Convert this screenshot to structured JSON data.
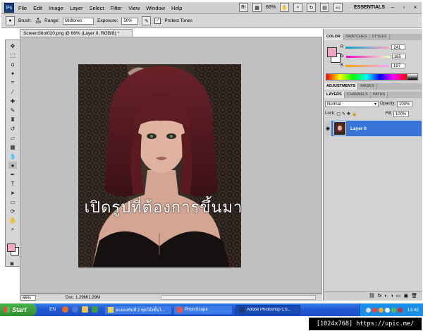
{
  "menubar": {
    "logo": "Ps",
    "items": [
      "File",
      "Edit",
      "Image",
      "Layer",
      "Select",
      "Filter",
      "View",
      "Window",
      "Help"
    ],
    "zoom": "66%",
    "workspace": "ESSENTIALS",
    "minimize": "–",
    "restore": "▫",
    "close": "×"
  },
  "options": {
    "brush_label": "Brush:",
    "brush_size": "109",
    "range_label": "Range:",
    "range_value": "Midtones",
    "exposure_label": "Exposure:",
    "exposure_value": "50%",
    "protect_label": "Protect Tones",
    "protect_checked": true
  },
  "document": {
    "tab_title": "ScreenShot020.png @ 66% (Layer 0, RGB/8) *",
    "overlay_text": "เปิดรูปที่ต้องการขึ้นมา",
    "status_zoom": "66%",
    "status_doc": "Doc: 1.29M/1.29M"
  },
  "color_panel": {
    "tabs": [
      "COLOR",
      "SWATCHES",
      "STYLES"
    ],
    "r_label": "R",
    "r": "241",
    "g_label": "G",
    "g": "165",
    "b_label": "B",
    "b": "197",
    "foreground": "#f1a5c5"
  },
  "adjustments": {
    "tabs": [
      "ADJUSTMENTS",
      "MASKS"
    ]
  },
  "layers_panel": {
    "tabs": [
      "LAYERS",
      "CHANNELS",
      "PATHS"
    ],
    "blend_mode": "Normal",
    "opacity_label": "Opacity:",
    "opacity": "100%",
    "lock_label": "Lock:",
    "fill_label": "Fill:",
    "fill": "100%",
    "layer_name": "Layer 0"
  },
  "taskbar": {
    "start_label": "Start",
    "language": "EN",
    "tasks": [
      "ละอองขันที่ 2 ชุดโอ๊งขั้นไ...",
      "PhotoScape",
      "Adobe Photoshop CS..."
    ],
    "clock": "13:45"
  },
  "watermark": "[1024x768] https://upic.me/",
  "colors": {
    "accent": "#3875d7",
    "taskbar": "#2157d3",
    "hair": "#5a1d22"
  }
}
